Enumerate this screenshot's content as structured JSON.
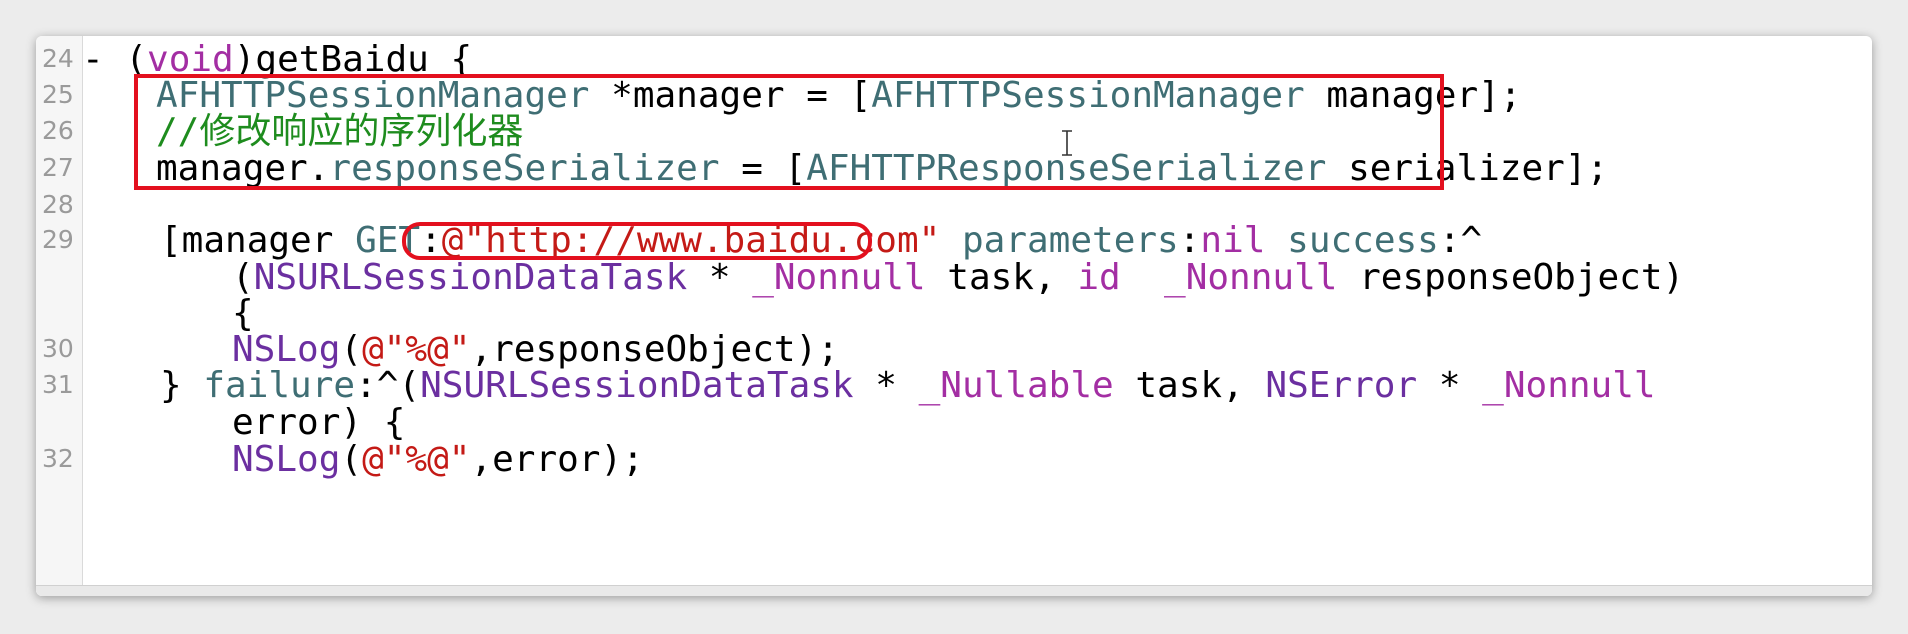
{
  "editor": {
    "lines": [
      {
        "num": "24",
        "tokens": [
          [
            "p",
            "- ("
          ],
          [
            "kw",
            "void"
          ],
          [
            "p",
            ")getBaidu {"
          ]
        ]
      },
      {
        "num": "25",
        "tokens": [
          [
            "ty",
            "AFHTTPSessionManager"
          ],
          [
            "p",
            " *manager = ["
          ],
          [
            "ty",
            "AFHTTPSessionManager"
          ],
          [
            "p",
            " manager];"
          ]
        ]
      },
      {
        "num": "26",
        "tokens": [
          [
            "cm",
            "//修改响应的序列化器"
          ]
        ]
      },
      {
        "num": "27",
        "tokens": [
          [
            "p",
            "manager."
          ],
          [
            "ty",
            "responseSerializer"
          ],
          [
            "p",
            " = ["
          ],
          [
            "ty",
            "AFHTTPResponseSerializer"
          ],
          [
            "p",
            " serializer];"
          ]
        ]
      },
      {
        "num": "28",
        "tokens": []
      },
      {
        "num": "29",
        "tokens": [
          [
            "p",
            "[manager "
          ],
          [
            "ty",
            "GET"
          ],
          [
            "p",
            ":"
          ],
          [
            "str",
            "@\"http://www.baidu.com\""
          ],
          [
            "p",
            " "
          ],
          [
            "ty",
            "parameters"
          ],
          [
            "p",
            ":"
          ],
          [
            "kw",
            "nil"
          ],
          [
            "p",
            " "
          ],
          [
            "ty",
            "success"
          ],
          [
            "p",
            ":^"
          ]
        ]
      },
      {
        "num": "",
        "tokens": [
          [
            "p",
            "("
          ],
          [
            "cls",
            "NSURLSessionDataTask"
          ],
          [
            "p",
            " * "
          ],
          [
            "kw",
            "_Nonnull"
          ],
          [
            "p",
            " task, "
          ],
          [
            "kw",
            "id"
          ],
          [
            "p",
            "  "
          ],
          [
            "kw",
            "_Nonnull"
          ],
          [
            "p",
            " responseObject)"
          ]
        ]
      },
      {
        "num": "",
        "tokens": [
          [
            "p",
            "{"
          ]
        ]
      },
      {
        "num": "30",
        "tokens": [
          [
            "cls",
            "NSLog"
          ],
          [
            "p",
            "("
          ],
          [
            "str",
            "@\"%@\""
          ],
          [
            "p",
            ",responseObject);"
          ]
        ]
      },
      {
        "num": "31",
        "tokens": [
          [
            "p",
            "} "
          ],
          [
            "ty",
            "failure"
          ],
          [
            "p",
            ":^("
          ],
          [
            "cls",
            "NSURLSessionDataTask"
          ],
          [
            "p",
            " * "
          ],
          [
            "kw",
            "_Nullable"
          ],
          [
            "p",
            " task, "
          ],
          [
            "cls",
            "NSError"
          ],
          [
            "p",
            " * "
          ],
          [
            "kw",
            "_Nonnull"
          ]
        ]
      },
      {
        "num": "",
        "tokens": [
          [
            "p",
            "error) {"
          ]
        ]
      },
      {
        "num": "32",
        "tokens": [
          [
            "cls",
            "NSLog"
          ],
          [
            "p",
            "("
          ],
          [
            "str",
            "@\"%@\""
          ],
          [
            "p",
            ",error);"
          ]
        ]
      }
    ]
  },
  "annotations": {
    "box_color": "#e3101e"
  },
  "colors": {
    "keyword": "#a32ea3",
    "type": "#3f6e74",
    "class": "#6b2fa0",
    "string": "#c41a16",
    "comment": "#1e8c1e"
  },
  "icons": {
    "cursor": "text-cursor-icon"
  }
}
